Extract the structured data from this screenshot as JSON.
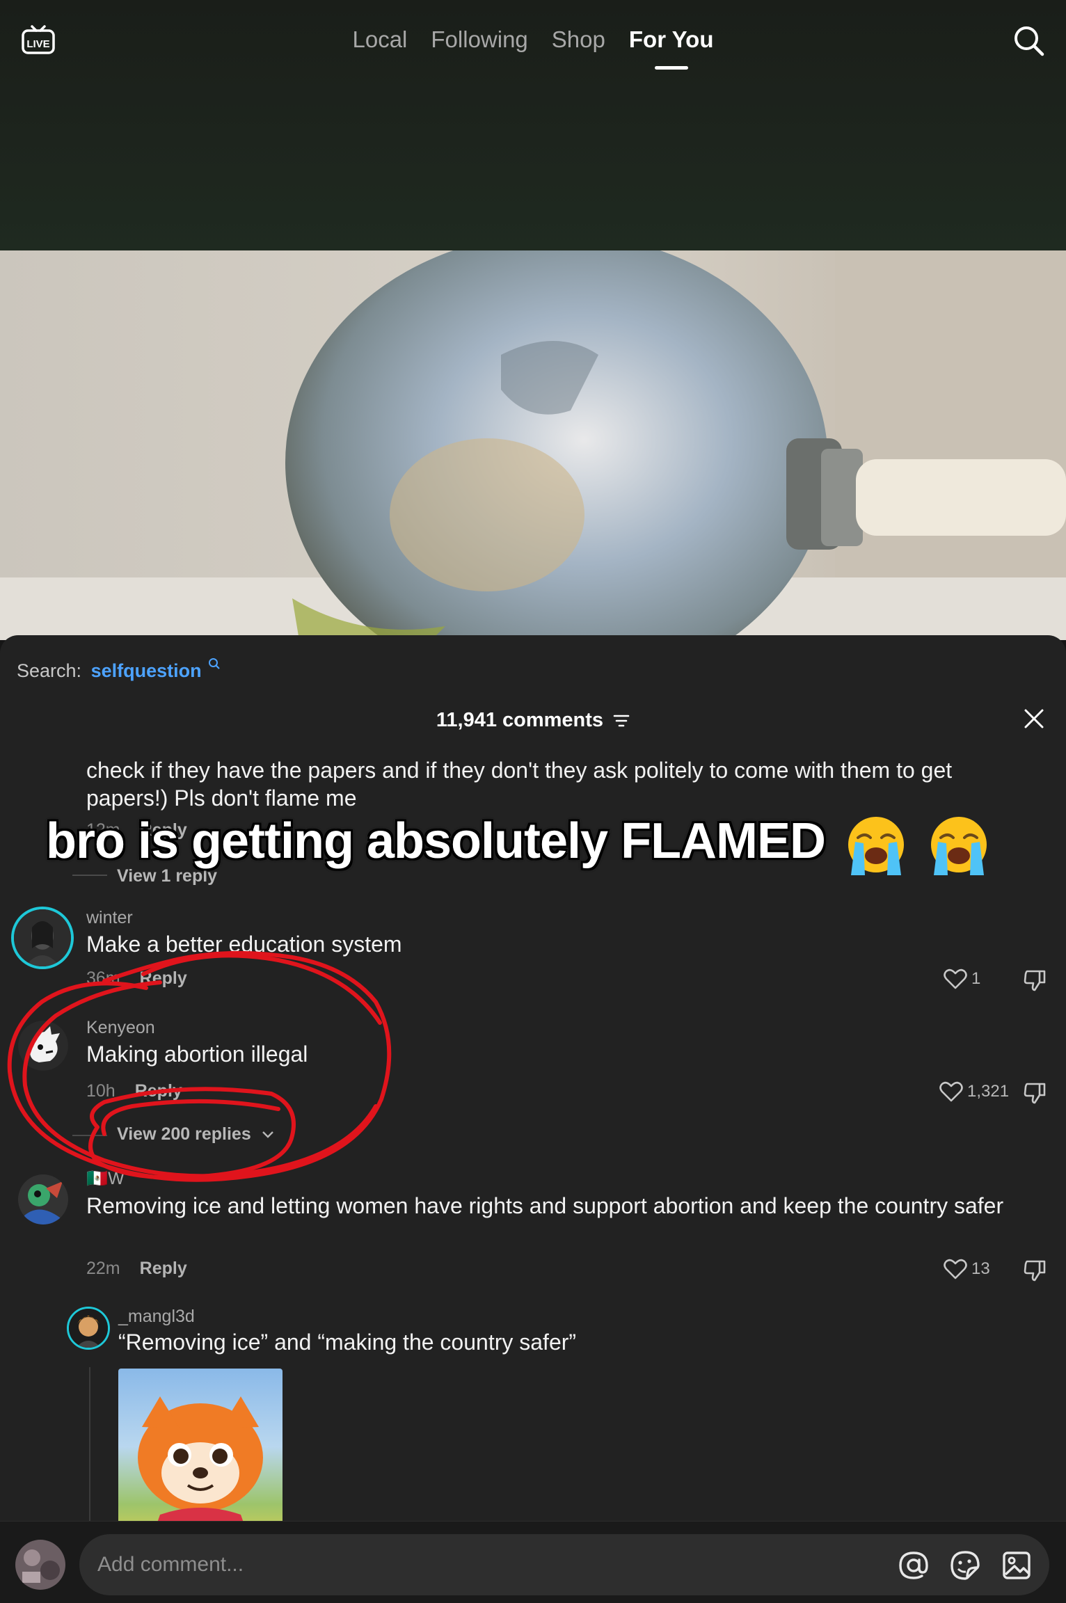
{
  "topnav": {
    "live_icon": "live-tv-icon",
    "tabs": [
      {
        "label": "Local"
      },
      {
        "label": "Following"
      },
      {
        "label": "Shop"
      },
      {
        "label": "For You"
      }
    ],
    "active_tab": "For You",
    "search_icon": "search-icon"
  },
  "sheet": {
    "search_prefix": "Search:",
    "search_term": "selfquestion",
    "comment_count": "11,941 comments",
    "filter_icon": "sort-filter-icon",
    "close_icon": "close-icon"
  },
  "caption": {
    "text": "bro is getting absolutely FLAMED",
    "emoji": "loudly-crying-face-emoji"
  },
  "comments": [
    {
      "text_partial": "check if they have the papers and if they don't they ask politely to come with them to get papers!) Pls don't flame me",
      "time_partial": "12m",
      "reply_label": "Reply",
      "view_replies_partial": "View 1 reply"
    },
    {
      "username": "winter",
      "text": "Make a better education system",
      "time": "36m",
      "reply_label": "Reply",
      "likes": "1"
    },
    {
      "username": "Kenyeon",
      "text": "Making abortion illegal",
      "time": "10h",
      "reply_label": "Reply",
      "likes": "1,321",
      "view_replies": "View 200 replies"
    },
    {
      "username": "🇲🇽W",
      "text": "Removing ice and letting women have rights and support abortion and keep the country safer",
      "time": "22m",
      "reply_label": "Reply",
      "likes": "13"
    },
    {
      "username": "_mangl3d",
      "text": "“Removing ice” and “making the country safer”",
      "is_reply": true
    }
  ],
  "bottom_bar": {
    "placeholder": "Add comment...",
    "icons": [
      "mention-at-icon",
      "sticker-emoji-icon",
      "image-picker-icon"
    ]
  },
  "annotation": {
    "color": "#e0141c",
    "note": "red hand-drawn circles around Kenyeon comment and View 200 replies"
  },
  "colors": {
    "sheet_bg": "#222222",
    "link_blue": "#4da3ff",
    "avatar_ring": "#1ec8d8"
  }
}
